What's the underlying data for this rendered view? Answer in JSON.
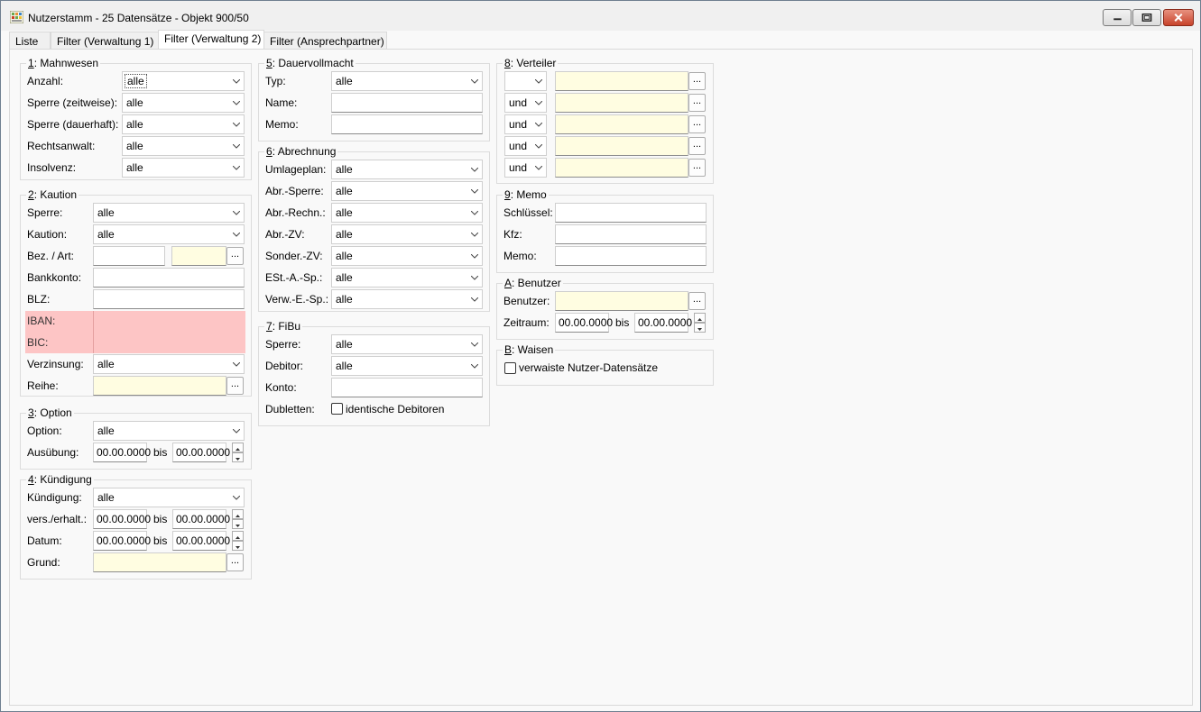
{
  "window": {
    "title": "Nutzerstamm - 25 Datensätze - Objekt 900/50"
  },
  "tabs": [
    {
      "label": "Liste"
    },
    {
      "label": "Filter (Verwaltung 1)"
    },
    {
      "label": "Filter (Verwaltung 2)"
    },
    {
      "label": "Filter (Ansprechpartner)"
    }
  ],
  "common": {
    "bis": "bis",
    "dots": "...",
    "date_placeholder": "00.00.0000"
  },
  "mahnwesen": {
    "title_key": "1",
    "title_rest": ": Mahnwesen",
    "rows": [
      {
        "label": "Anzahl:",
        "value": "alle"
      },
      {
        "label": "Sperre (zeitweise):",
        "value": "alle"
      },
      {
        "label": "Sperre (dauerhaft):",
        "value": "alle"
      },
      {
        "label": "Rechtsanwalt:",
        "value": "alle"
      },
      {
        "label": "Insolvenz:",
        "value": "alle"
      }
    ]
  },
  "kaution": {
    "title_key": "2",
    "title_rest": ": Kaution",
    "sperre_label": "Sperre:",
    "sperre_value": "alle",
    "kaution_label": "Kaution:",
    "kaution_value": "alle",
    "bez_label": "Bez. / Art:",
    "bankkonto_label": "Bankkonto:",
    "blz_label": "BLZ:",
    "iban_label": "IBAN:",
    "bic_label": "BIC:",
    "verzinsung_label": "Verzinsung:",
    "verzinsung_value": "alle",
    "reihe_label": "Reihe:"
  },
  "option": {
    "title_key": "3",
    "title_rest": ": Option",
    "option_label": "Option:",
    "option_value": "alle",
    "ausuebung_label": "Ausübung:",
    "from": "00.00.0000",
    "to": "00.00.0000"
  },
  "kuendigung": {
    "title_key": "4",
    "title_rest": ": Kündigung",
    "kuendigung_label": "Kündigung:",
    "kuendigung_value": "alle",
    "vers_label": "vers./erhalt.:",
    "vers_from": "00.00.0000",
    "vers_to": "00.00.0000",
    "datum_label": "Datum:",
    "datum_from": "00.00.0000",
    "datum_to": "00.00.0000",
    "grund_label": "Grund:"
  },
  "dauervollmacht": {
    "title_key": "5",
    "title_rest": ": Dauervollmacht",
    "typ_label": "Typ:",
    "typ_value": "alle",
    "name_label": "Name:",
    "memo_label": "Memo:"
  },
  "abrechnung": {
    "title_key": "6",
    "title_rest": ": Abrechnung",
    "rows": [
      {
        "label": "Umlageplan:",
        "value": "alle"
      },
      {
        "label": "Abr.-Sperre:",
        "value": "alle"
      },
      {
        "label": "Abr.-Rechn.:",
        "value": "alle"
      },
      {
        "label": "Abr.-ZV:",
        "value": "alle"
      },
      {
        "label": "Sonder.-ZV:",
        "value": "alle"
      },
      {
        "label": "ESt.-A.-Sp.:",
        "value": "alle"
      },
      {
        "label": "Verw.-E.-Sp.:",
        "value": "alle"
      }
    ]
  },
  "fibu": {
    "title_key": "7",
    "title_rest": ": FiBu",
    "sperre_label": "Sperre:",
    "sperre_value": "alle",
    "debitor_label": "Debitor:",
    "debitor_value": "alle",
    "konto_label": "Konto:",
    "dubletten_label": "Dubletten:",
    "dubletten_check": "identische Debitoren"
  },
  "verteiler": {
    "title_key": "8",
    "title_rest": ": Verteiler",
    "rows": [
      {
        "op": ""
      },
      {
        "op": "und"
      },
      {
        "op": "und"
      },
      {
        "op": "und"
      },
      {
        "op": "und"
      }
    ]
  },
  "memo": {
    "title_key": "9",
    "title_rest": ": Memo",
    "schluessel_label": "Schlüssel:",
    "kfz_label": "Kfz:",
    "memo_label": "Memo:"
  },
  "benutzer": {
    "title_key": "A",
    "title_rest": ": Benutzer",
    "benutzer_label": "Benutzer:",
    "zeitraum_label": "Zeitraum:",
    "from": "00.00.0000",
    "to": "00.00.0000"
  },
  "waisen": {
    "title_key": "B",
    "title_rest": ": Waisen",
    "check_label": "verwaiste Nutzer-Datensätze"
  }
}
